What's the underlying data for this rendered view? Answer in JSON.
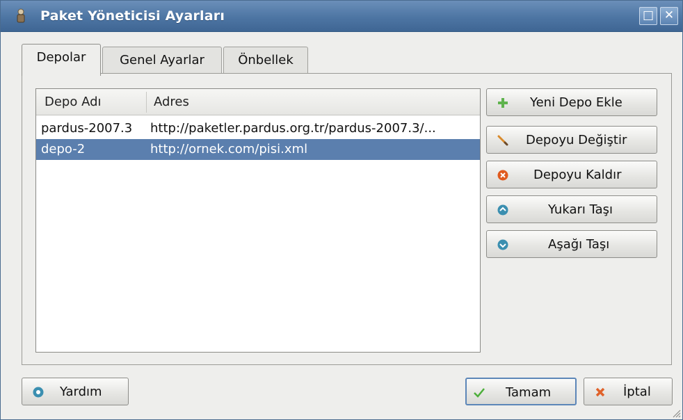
{
  "window": {
    "title": "Paket Yöneticisi Ayarları",
    "maximize_glyph": "□",
    "close_glyph": "✕"
  },
  "tabs": [
    {
      "label": "Depolar",
      "active": true
    },
    {
      "label": "Genel Ayarlar",
      "active": false
    },
    {
      "label": "Önbellek",
      "active": false
    }
  ],
  "repo_list": {
    "columns": [
      "Depo Adı",
      "Adres"
    ],
    "rows": [
      {
        "name": "pardus-2007.3",
        "address": "http://paketler.pardus.org.tr/pardus-2007.3/...",
        "selected": false
      },
      {
        "name": "depo-2",
        "address": "http://ornek.com/pisi.xml",
        "selected": true
      }
    ]
  },
  "side_buttons": [
    {
      "label": "Yeni Depo Ekle",
      "icon": "plus-icon",
      "color": "#5fb34d"
    },
    {
      "label": "Depoyu Değiştir",
      "icon": "edit-icon",
      "color": "#d98a2b"
    },
    {
      "label": "Depoyu Kaldır",
      "icon": "remove-icon",
      "color": "#e05a1e"
    },
    {
      "label": "Yukarı Taşı",
      "icon": "arrow-up-icon",
      "color": "#3b8fb0"
    },
    {
      "label": "Aşağı Taşı",
      "icon": "arrow-down-icon",
      "color": "#3b8fb0"
    }
  ],
  "footer": {
    "help_label": "Yardım",
    "ok_label": "Tamam",
    "cancel_label": "İptal"
  },
  "colors": {
    "titlebar": "#4d75a3",
    "selection": "#5b7fae",
    "ok_check": "#4caf3a",
    "cancel_x": "#e0622a"
  }
}
